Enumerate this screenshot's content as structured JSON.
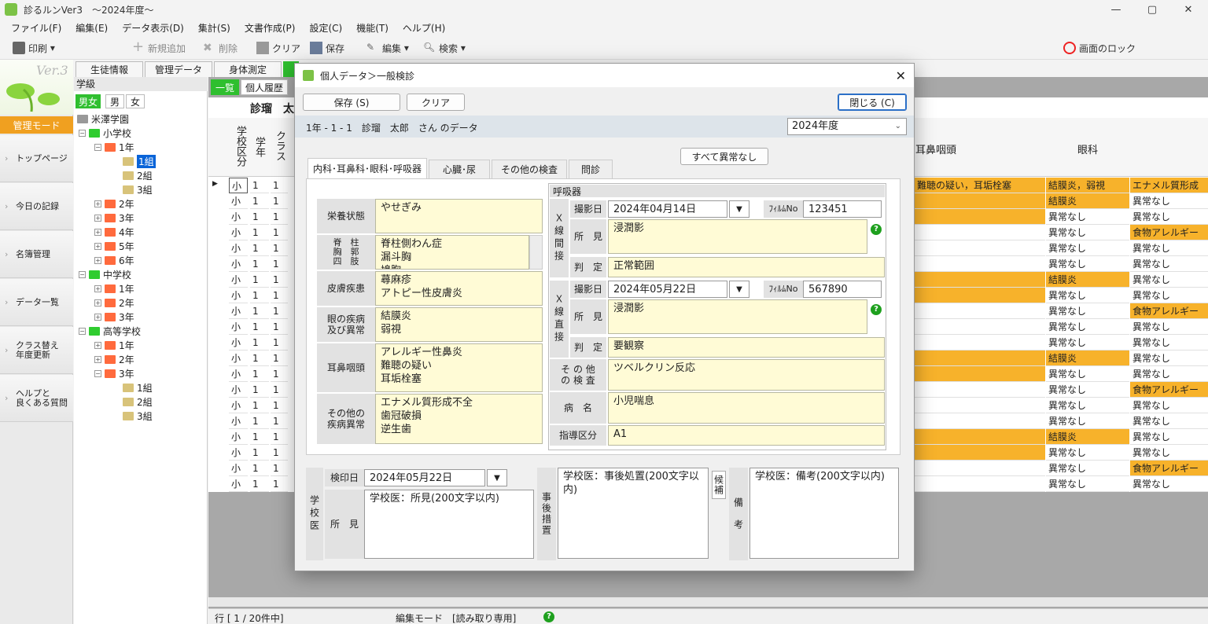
{
  "window": {
    "title": "診るルンVer3　～2024年度～",
    "min": "—",
    "max": "▢",
    "close": "✕"
  },
  "menu": [
    "ファイル(F)",
    "編集(E)",
    "データ表示(D)",
    "集計(S)",
    "文書作成(P)",
    "設定(C)",
    "機能(T)",
    "ヘルプ(H)"
  ],
  "toolbar": {
    "print": "印刷",
    "new": "新規追加",
    "delete": "削除",
    "clear": "クリア",
    "save": "保存",
    "edit": "編集",
    "search": "検索",
    "lock": "画面のロック"
  },
  "logo": {
    "text": "Ver.3"
  },
  "leftnav": {
    "mode": "管理モード",
    "items": [
      "トップページ",
      "今日の記録",
      "名簿管理",
      "データ一覧",
      "クラス替え\n年度更新",
      "ヘルプと\n良くある質問"
    ]
  },
  "tree": {
    "header": "学級",
    "gender": [
      "男女",
      "男",
      "女"
    ],
    "root": "米澤学園",
    "nodes": [
      {
        "label": "小学校"
      },
      {
        "label": "1年"
      },
      {
        "label": "1組"
      },
      {
        "label": "2組"
      },
      {
        "label": "3組"
      },
      {
        "label": "2年"
      },
      {
        "label": "3年"
      },
      {
        "label": "4年"
      },
      {
        "label": "5年"
      },
      {
        "label": "6年"
      },
      {
        "label": "中学校"
      },
      {
        "label": "1年"
      },
      {
        "label": "2年"
      },
      {
        "label": "3年"
      },
      {
        "label": "高等学校"
      },
      {
        "label": "1年"
      },
      {
        "label": "2年"
      },
      {
        "label": "3年"
      },
      {
        "label": "1組"
      },
      {
        "label": "2組"
      },
      {
        "label": "3組"
      }
    ]
  },
  "maintabs": [
    "生徒情報",
    "管理データ",
    "身体測定"
  ],
  "subtabs": [
    "一覧",
    "個人履歴"
  ],
  "grid": {
    "name_partial": "診瑠　太",
    "headers": {
      "school": "学校区分",
      "grade": "学年",
      "class": "クラス",
      "ent": "耳鼻咽頭",
      "eye": "眼科"
    },
    "rows": [
      {
        "s": "小",
        "g": "1",
        "c": "1",
        "ent": "難聴の疑い，耳垢栓塞",
        "eye": "結膜炎，弱視",
        "other": "エナメル質形成",
        "entHl": true,
        "eyeHl": true,
        "otherHl": true
      },
      {
        "s": "小",
        "g": "1",
        "c": "1",
        "ent": "",
        "eye": "結膜炎",
        "other": "異常なし",
        "entHl": true,
        "eyeHl": true,
        "otherHl": false
      },
      {
        "s": "小",
        "g": "1",
        "c": "1",
        "ent": "",
        "eye": "異常なし",
        "other": "異常なし",
        "entHl": true,
        "eyeHl": false,
        "otherHl": false
      },
      {
        "s": "小",
        "g": "1",
        "c": "1",
        "ent": "",
        "eye": "異常なし",
        "other": "食物アレルギー",
        "entHl": false,
        "eyeHl": false,
        "otherHl": true
      },
      {
        "s": "小",
        "g": "1",
        "c": "1",
        "ent": "",
        "eye": "異常なし",
        "other": "異常なし",
        "entHl": false,
        "eyeHl": false,
        "otherHl": false
      },
      {
        "s": "小",
        "g": "1",
        "c": "1",
        "ent": "",
        "eye": "異常なし",
        "other": "異常なし",
        "entHl": false,
        "eyeHl": false,
        "otherHl": false
      },
      {
        "s": "小",
        "g": "1",
        "c": "1",
        "ent": "",
        "eye": "結膜炎",
        "other": "異常なし",
        "entHl": true,
        "eyeHl": true,
        "otherHl": false
      },
      {
        "s": "小",
        "g": "1",
        "c": "1",
        "ent": "",
        "eye": "異常なし",
        "other": "異常なし",
        "entHl": true,
        "eyeHl": false,
        "otherHl": false
      },
      {
        "s": "小",
        "g": "1",
        "c": "1",
        "ent": "",
        "eye": "異常なし",
        "other": "食物アレルギー",
        "entHl": false,
        "eyeHl": false,
        "otherHl": true
      },
      {
        "s": "小",
        "g": "1",
        "c": "1",
        "ent": "",
        "eye": "異常なし",
        "other": "異常なし",
        "entHl": false,
        "eyeHl": false,
        "otherHl": false
      },
      {
        "s": "小",
        "g": "1",
        "c": "1",
        "ent": "",
        "eye": "異常なし",
        "other": "異常なし",
        "entHl": false,
        "eyeHl": false,
        "otherHl": false
      },
      {
        "s": "小",
        "g": "1",
        "c": "1",
        "ent": "",
        "eye": "結膜炎",
        "other": "異常なし",
        "entHl": true,
        "eyeHl": true,
        "otherHl": false
      },
      {
        "s": "小",
        "g": "1",
        "c": "1",
        "ent": "",
        "eye": "異常なし",
        "other": "異常なし",
        "entHl": true,
        "eyeHl": false,
        "otherHl": false
      },
      {
        "s": "小",
        "g": "1",
        "c": "1",
        "ent": "",
        "eye": "異常なし",
        "other": "食物アレルギー",
        "entHl": false,
        "eyeHl": false,
        "otherHl": true
      },
      {
        "s": "小",
        "g": "1",
        "c": "1",
        "ent": "",
        "eye": "異常なし",
        "other": "異常なし",
        "entHl": false,
        "eyeHl": false,
        "otherHl": false
      },
      {
        "s": "小",
        "g": "1",
        "c": "1",
        "ent": "",
        "eye": "異常なし",
        "other": "異常なし",
        "entHl": false,
        "eyeHl": false,
        "otherHl": false
      },
      {
        "s": "小",
        "g": "1",
        "c": "1",
        "ent": "",
        "eye": "結膜炎",
        "other": "異常なし",
        "entHl": true,
        "eyeHl": true,
        "otherHl": false
      },
      {
        "s": "小",
        "g": "1",
        "c": "1",
        "ent": "",
        "eye": "異常なし",
        "other": "異常なし",
        "entHl": true,
        "eyeHl": false,
        "otherHl": false
      },
      {
        "s": "小",
        "g": "1",
        "c": "1",
        "ent": "",
        "eye": "異常なし",
        "other": "食物アレルギー",
        "entHl": false,
        "eyeHl": false,
        "otherHl": true
      },
      {
        "s": "小",
        "g": "1",
        "c": "1",
        "ent": "",
        "eye": "異常なし",
        "other": "異常なし",
        "entHl": false,
        "eyeHl": false,
        "otherHl": false
      }
    ]
  },
  "status": {
    "rows": "行 [ 1 / 20件中]",
    "mode": "編集モード　[読み取り専用]"
  },
  "dialog": {
    "title": "個人データ＞一般検診",
    "close": "✕",
    "save": "保存 (S)",
    "clear": "クリア",
    "close_btn": "閉じる (C)",
    "student": "1年 - 1 - 1　診瑠　太郎　さん のデータ",
    "year": "2024年度",
    "all_normal": "すべて異常なし",
    "tabs": [
      "内科･耳鼻科･眼科･呼吸器",
      "心臓･尿",
      "その他の検査",
      "問診"
    ],
    "left": [
      {
        "label": "栄養状態",
        "value": "やせぎみ"
      },
      {
        "label": "脊　柱\n胸　郭\n四　肢",
        "value": "脊柱側わん症\n漏斗胸\n鳩胸"
      },
      {
        "label": "皮膚疾患",
        "value": "蕁麻疹\nアトピー性皮膚炎"
      },
      {
        "label": "眼の疾病\n及び異常",
        "value": "結膜炎\n弱視"
      },
      {
        "label": "耳鼻咽頭",
        "value": "アレルギー性鼻炎\n難聴の疑い\n耳垢栓塞"
      },
      {
        "label": "その他の\n疾病異常",
        "value": "エナメル質形成不全\n歯冠破損\n逆生歯"
      }
    ],
    "resp": {
      "header": "呼吸器",
      "xray1": {
        "group": "Ｘ線間接",
        "date_label": "撮影日",
        "date": "2024年04月14日",
        "film_label": "ﾌｨﾙﾑNo",
        "film": "123451",
        "find_label": "所　見",
        "find": "浸潤影",
        "judge_label": "判　定",
        "judge": "正常範囲"
      },
      "xray2": {
        "group": "Ｘ線直接",
        "date_label": "撮影日",
        "date": "2024年05月22日",
        "film_label": "ﾌｨﾙﾑNo",
        "film": "567890",
        "find_label": "所　見",
        "find": "浸潤影",
        "judge_label": "判　定",
        "judge": "要観察"
      },
      "other_label": "そ の 他\nの 検 査",
      "other": "ツベルクリン反応",
      "disease_label": "病　名",
      "disease": "小児喘息",
      "guide_label": "指導区分",
      "guide": "A1"
    },
    "doctor": {
      "group": "学校医",
      "date_label": "検印日",
      "date": "2024年05月22日",
      "find_label": "所　見",
      "find": "学校医：所見(200文字以内)",
      "action_label": "事後措置",
      "action": "学校医：事後処置(200文字以内)",
      "cand": "候補",
      "note_label": "備　考",
      "note": "学校医：備考(200文字以内)"
    }
  }
}
